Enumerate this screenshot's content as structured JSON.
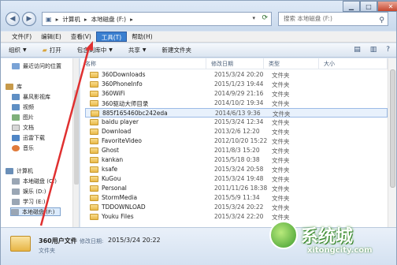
{
  "address": {
    "crumbs": [
      "计算机",
      "本地磁盘 (F:)"
    ],
    "search_placeholder": "搜索 本地磁盘 (F:)"
  },
  "menu": [
    "文件(F)",
    "编辑(E)",
    "查看(V)",
    "工具(T)",
    "帮助(H)"
  ],
  "menu_active_index": 3,
  "toolbar": {
    "organize": "组织",
    "open": "打开",
    "include": "包含到库中",
    "share": "共享",
    "new_folder": "新建文件夹"
  },
  "nav": [
    {
      "label": "最近访问的位置",
      "kind": "recent"
    },
    {
      "label": "库",
      "kind": "library"
    },
    {
      "label": "暴风影视库",
      "kind": "video"
    },
    {
      "label": "视频",
      "kind": "video"
    },
    {
      "label": "图片",
      "kind": "image"
    },
    {
      "label": "文档",
      "kind": "doc"
    },
    {
      "label": "迅雷下载",
      "kind": "thunder"
    },
    {
      "label": "音乐",
      "kind": "music"
    },
    {
      "label": "计算机",
      "kind": "computer"
    },
    {
      "label": "本地磁盘 (C:)",
      "kind": "disk"
    },
    {
      "label": "娱乐 (D:)",
      "kind": "disk"
    },
    {
      "label": "学习 (E:)",
      "kind": "disk"
    },
    {
      "label": "本地磁盘 (F:)",
      "kind": "disk",
      "selected": true
    }
  ],
  "columns": {
    "name": "名称",
    "date": "修改日期",
    "type": "类型",
    "size": "大小"
  },
  "files": [
    {
      "name": "360Downloads",
      "date": "2015/3/24 20:20",
      "type": "文件夹"
    },
    {
      "name": "360PhoneInfo",
      "date": "2015/1/23 19:44",
      "type": "文件夹"
    },
    {
      "name": "360WiFi",
      "date": "2014/9/29 21:16",
      "type": "文件夹"
    },
    {
      "name": "360驱动大师目录",
      "date": "2014/10/2 19:34",
      "type": "文件夹"
    },
    {
      "name": "885f165460bc242eda",
      "date": "2014/6/13 9:36",
      "type": "文件夹",
      "selected": true
    },
    {
      "name": "baidu player",
      "date": "2015/3/24 12:34",
      "type": "文件夹"
    },
    {
      "name": "Download",
      "date": "2013/2/6 12:20",
      "type": "文件夹"
    },
    {
      "name": "FavoriteVideo",
      "date": "2012/10/20 15:22",
      "type": "文件夹"
    },
    {
      "name": "Ghost",
      "date": "2011/8/3 15:20",
      "type": "文件夹"
    },
    {
      "name": "kankan",
      "date": "2015/5/18 0:38",
      "type": "文件夹"
    },
    {
      "name": "ksafe",
      "date": "2015/3/24 20:58",
      "type": "文件夹"
    },
    {
      "name": "KuGou",
      "date": "2015/3/24 19:48",
      "type": "文件夹"
    },
    {
      "name": "Personal",
      "date": "2011/11/26 18:38",
      "type": "文件夹"
    },
    {
      "name": "StormMedia",
      "date": "2015/5/9 11:34",
      "type": "文件夹"
    },
    {
      "name": "TDDOWNLOAD",
      "date": "2015/3/24 20:22",
      "type": "文件夹"
    },
    {
      "name": "Youku Files",
      "date": "2015/3/24 22:20",
      "type": "文件夹"
    }
  ],
  "details": {
    "name": "360用户文件",
    "date_label": "修改日期:",
    "date_value": "2015/3/24 20:22",
    "type": "文件夹"
  },
  "watermark": {
    "text": "系统城",
    "url": "xitongcity.com"
  },
  "colors": {
    "accent": "#3a7fd0",
    "arrow": "#e03030",
    "folder": "#e9b949"
  }
}
